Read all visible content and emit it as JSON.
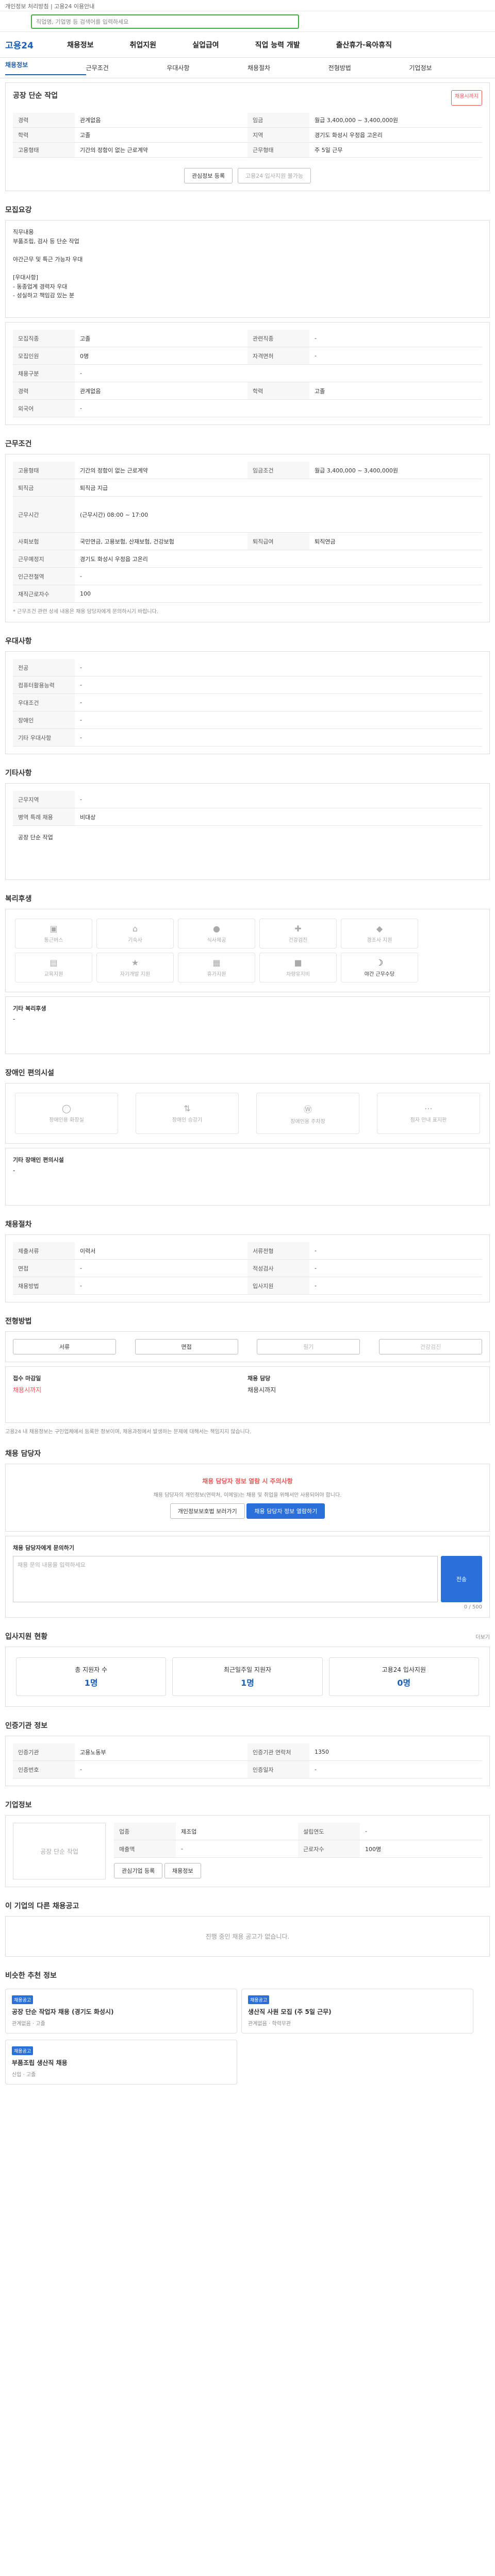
{
  "banner": "개인정보 처리방침 | 고용24 이용안내",
  "search": {
    "placeholder": "직업명, 기업명 등 검색어를 입력하세요"
  },
  "header": {
    "logo": "고용24",
    "menu": [
      "채용정보",
      "취업지원",
      "실업급여",
      "직업 능력 개발",
      "출산휴가·육아휴직"
    ]
  },
  "tabs": [
    "채용정보",
    "근무조건",
    "우대사항",
    "채용절차",
    "전형방법",
    "기업정보"
  ],
  "job": {
    "company": "공장 단순 작업",
    "tag": "채용시까지",
    "summary": [
      {
        "label": "경력",
        "value": "관계없음"
      },
      {
        "label": "임금",
        "value": "월급 3,400,000 ~ 3,400,000원"
      },
      {
        "label": "학력",
        "value": "고졸"
      },
      {
        "label": "지역",
        "value": "경기도 화성시 우정읍 고온리"
      },
      {
        "label": "고용형태",
        "value": "기간의 정함이 없는 근로계약"
      },
      {
        "label": "근무형태",
        "value": "주 5일 근무"
      }
    ],
    "apply_button": "관심정보 등록",
    "share_button": "고용24 입사지원 불가능"
  },
  "overview": {
    "title": "모집요강",
    "body": "직무내용\n부품조립, 검사 등 단순 작업\n\n야간근무 및 특근 가능자 우대\n\n[우대사항]\n- 동종업계 경력자 우대\n- 성실하고 책임감 있는 분"
  },
  "recruit": {
    "rows": [
      {
        "k": "모집직종",
        "v": "고졸",
        "k2": "관련직종",
        "v2": "-"
      },
      {
        "k": "모집인원",
        "v": "0명",
        "k2": "자격면허",
        "v2": "-"
      },
      {
        "k": "채용구분",
        "v": "-"
      },
      {
        "k": "경력",
        "v": "관계없음",
        "k2": "학력",
        "v2": "고졸"
      },
      {
        "k": "외국어",
        "v": "-"
      }
    ]
  },
  "conditions": {
    "title": "근무조건",
    "rows": [
      {
        "k": "고용형태",
        "v": "기간의 정함이 없는 근로계약",
        "k2": "임금조건",
        "v2": "월급 3,400,000 ~ 3,400,000원"
      },
      {
        "k": "퇴직금",
        "v": "퇴직금 지급"
      },
      {
        "k": "근무시간",
        "v": "(근무시간) 08:00 ~ 17:00"
      },
      {
        "k": "사회보험",
        "v": "국민연금, 고용보험, 산재보험, 건강보험",
        "k2": "퇴직급여",
        "v2": "퇴직연금"
      },
      {
        "k": "근무예정지",
        "v": "경기도 화성시 우정읍 고온리"
      },
      {
        "k": "인근전철역",
        "v": "-"
      },
      {
        "k": "재직근로자수",
        "v": "100"
      }
    ],
    "note": "* 근무조건 관련 상세 내용은 채용 담당자에게 문의하시기 바랍니다."
  },
  "pref": {
    "title": "우대사항",
    "rows": [
      {
        "k": "전공",
        "v": "-"
      },
      {
        "k": "컴퓨터활용능력",
        "v": "-"
      },
      {
        "k": "우대조건",
        "v": "-"
      },
      {
        "k": "장애인",
        "v": "-"
      },
      {
        "k": "기타 우대사항",
        "v": "-"
      }
    ]
  },
  "etc": {
    "title": "기타사항",
    "rows": [
      {
        "k": "근무지역",
        "v": "-"
      },
      {
        "k": "병역 특례 채용",
        "v": "비대상"
      }
    ],
    "detail": "공장 단순 작업"
  },
  "welfare": {
    "title": "복리후생",
    "items": [
      "통근버스",
      "기숙사",
      "식사제공",
      "건강검진",
      "경조사 지원",
      "교육지원",
      "자기개발 지원",
      "휴가지원",
      "차량유지비",
      "야간 근무수당"
    ],
    "label": "기타 복리후생",
    "value": "-"
  },
  "disability": {
    "title": "장애인 편의시설",
    "items": [
      "장애인용 화장실",
      "장애인 승강기",
      "장애인용 주차장",
      "점자 안내 표지판"
    ],
    "label": "기타 장애인 편의시설",
    "value": "-"
  },
  "process": {
    "title": "채용절차",
    "rows": [
      {
        "k": "제출서류",
        "v": "이력서",
        "k2": "서류전형",
        "v2": "-"
      },
      {
        "k": "면접",
        "v": "-",
        "k2": "적성검사",
        "v2": "-"
      },
      {
        "k": "채용방법",
        "v": "-",
        "k2": "입사지원",
        "v2": "-"
      }
    ]
  },
  "method": {
    "title": "전형방법",
    "steps": [
      "서류",
      "면접",
      "필기",
      "건강검진"
    ]
  },
  "apply": {
    "title": "접수방법",
    "deadline_label": "접수 마감일",
    "deadline": "채용시까지",
    "contact_label": "채용 담당",
    "contact": "채용시까지"
  },
  "notice": "고용24 내 채용정보는 구인업체에서 등록한 정보이며, 채용과정에서 발생하는 문제에 대해서는 책임지지 않습니다.",
  "contact_warn": {
    "title": "채용 담당자",
    "badge": "채용 담당자 정보 열람 시 주의사항",
    "text": "채용 담당자의 개인정보(연락처, 이메일)는 채용 및 취업을 위해서만 사용되어야 합니다.",
    "btn1": "개인정보보호법 보러가기",
    "btn2": "채용 담당자 정보 열람하기"
  },
  "inquiry": {
    "title": "채용 담당자에게 문의하기",
    "placeholder": "채용 문의 내용을 입력하세요",
    "counter": "0 / 500",
    "submit": "전송"
  },
  "stats": {
    "title": "입사지원 현황",
    "items": [
      {
        "k": "총 지원자 수",
        "v": "1명"
      },
      {
        "k": "최근일주일 지원자",
        "v": "1명"
      },
      {
        "k": "고용24 입사지원",
        "v": "0명"
      }
    ],
    "more": "더보기"
  },
  "agency": {
    "title": "인증기관 정보",
    "rows": [
      {
        "k": "인증기관",
        "v": "고용노동부",
        "k2": "인증기관 연락처",
        "v2": "1350"
      },
      {
        "k": "인증번호",
        "v": "-",
        "k2": "인증일자",
        "v2": "-"
      }
    ]
  },
  "company": {
    "title": "기업정보",
    "name": "공장 단순 작업",
    "rows": [
      {
        "k": "업종",
        "v": "제조업"
      },
      {
        "k": "설립연도",
        "v": "-"
      },
      {
        "k": "매출액",
        "v": "-"
      },
      {
        "k": "근로자수",
        "v": "100명"
      }
    ],
    "btn1": "관심기업 등록",
    "btn2": "채용정보"
  },
  "others": {
    "title": "이 기업의 다른 채용공고",
    "empty": "진행 중인 채용 공고가 없습니다."
  },
  "similar": {
    "title": "비슷한 추천 정보",
    "items": [
      {
        "tag": "채용공고",
        "title": "공장 단순 작업자 채용 (경기도 화성시)",
        "meta": "관계없음 · 고졸"
      },
      {
        "tag": "채용공고",
        "title": "생산직 사원 모집 (주 5일 근무)",
        "meta": "관계없음 · 학력무관"
      },
      {
        "tag": "채용공고",
        "title": "부품조립 생산직 채용",
        "meta": "신입 · 고졸"
      }
    ]
  }
}
